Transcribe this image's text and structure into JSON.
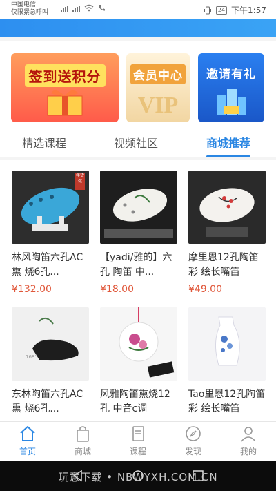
{
  "status_bar": {
    "carrier": "中国电信",
    "carrier_sub": "仅限紧急呼叫",
    "battery": "24",
    "time": "下午1:57"
  },
  "banners": [
    {
      "label": "签到送积分"
    },
    {
      "label": "会员中心"
    },
    {
      "label": "邀请有礼"
    }
  ],
  "tabs": [
    {
      "label": "精选课程"
    },
    {
      "label": "视频社区"
    },
    {
      "label": "商城推荐",
      "active": true
    }
  ],
  "products": [
    {
      "name": "林风陶笛六孔AC熏 烧6孔...",
      "price": "¥132.00",
      "tag": "年货促"
    },
    {
      "name": "【yadi/雅的】六孔 陶笛 中...",
      "price": "¥18.00"
    },
    {
      "name": "摩里恩12孔陶笛彩 绘长嘴笛",
      "price": "¥49.00"
    },
    {
      "name": "东林陶笛六孔AC熏 烧6孔...",
      "price": ""
    },
    {
      "name": "风雅陶笛熏烧12孔 中音c调",
      "price": ""
    },
    {
      "name": "Tao里恩12孔陶笛彩 绘长嘴笛",
      "price": ""
    }
  ],
  "bottom_nav": [
    {
      "label": "首页",
      "icon": "home-icon",
      "active": true
    },
    {
      "label": "商城",
      "icon": "shopping-bag-icon"
    },
    {
      "label": "课程",
      "icon": "book-icon"
    },
    {
      "label": "发现",
      "icon": "compass-icon"
    },
    {
      "label": "我的",
      "icon": "user-icon"
    }
  ],
  "watermark": "玩意下载 • NBWYXH.COM.CN",
  "colors": {
    "accent": "#2b87e3",
    "price": "#e0573a"
  }
}
